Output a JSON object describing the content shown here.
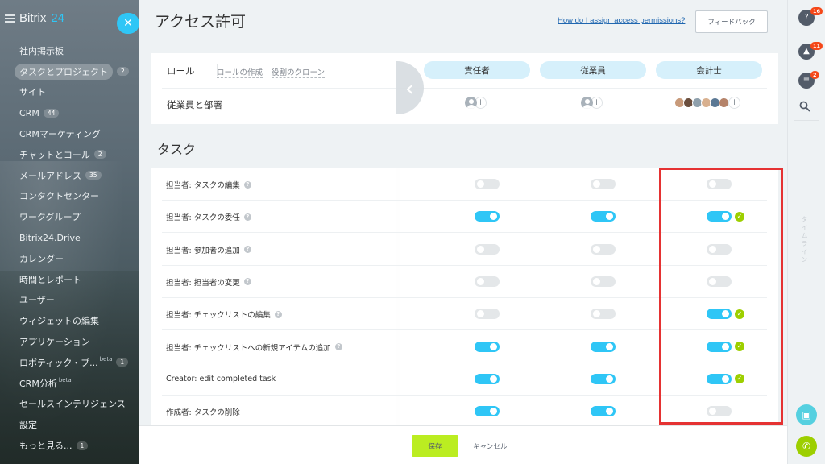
{
  "sidebar": {
    "logo_main": "Bitrix",
    "logo_accent": "24",
    "close_symbol": "✕",
    "items": [
      {
        "label": "社内掲示板",
        "badge": null,
        "sup": null
      },
      {
        "label": "タスクとプロジェクト",
        "badge": "2",
        "sup": null,
        "active": true
      },
      {
        "label": "サイト",
        "badge": null,
        "sup": null
      },
      {
        "label": "CRM",
        "badge": "44",
        "sup": null
      },
      {
        "label": "CRMマーケティング",
        "badge": null,
        "sup": null
      },
      {
        "label": "チャットとコール",
        "badge": "2",
        "sup": null
      },
      {
        "label": "メールアドレス",
        "badge": "35",
        "sup": null
      },
      {
        "label": "コンタクトセンター",
        "badge": null,
        "sup": null
      },
      {
        "label": "ワークグループ",
        "badge": null,
        "sup": null
      },
      {
        "label": "Bitrix24.Drive",
        "badge": null,
        "sup": null
      },
      {
        "label": "カレンダー",
        "badge": null,
        "sup": null
      },
      {
        "label": "時間とレポート",
        "badge": null,
        "sup": null
      },
      {
        "label": "ユーザー",
        "badge": null,
        "sup": null
      },
      {
        "label": "ウィジェットの編集",
        "badge": null,
        "sup": null
      },
      {
        "label": "アプリケーション",
        "badge": null,
        "sup": null
      },
      {
        "label": "ロボティック・プ...",
        "badge": "1",
        "sup": "beta"
      },
      {
        "label": "CRM分析",
        "badge": null,
        "sup": "beta"
      },
      {
        "label": "セールスインテリジェンス",
        "badge": null,
        "sup": null
      },
      {
        "label": "設定",
        "badge": null,
        "sup": null
      },
      {
        "label": "もっと見る...",
        "badge": "1",
        "sup": null
      }
    ]
  },
  "header": {
    "title": "アクセス許可",
    "help_link": "How do I assign access permissions?",
    "feedback": "フィードバック"
  },
  "roles": {
    "label": "ロール",
    "create_role": "ロールの作成",
    "clone_role": "役割のクローン",
    "members_label": "従業員と部署",
    "columns": [
      "責任者",
      "従業員",
      "会計士"
    ]
  },
  "section_title": "タスク",
  "permissions": [
    {
      "label": "担当者: タスクの編集",
      "help": true,
      "values": [
        false,
        false,
        false
      ],
      "changed": [
        false,
        false,
        false
      ]
    },
    {
      "label": "担当者: タスクの委任",
      "help": true,
      "values": [
        true,
        true,
        true
      ],
      "changed": [
        false,
        false,
        true
      ]
    },
    {
      "label": "担当者: 参加者の追加",
      "help": true,
      "values": [
        false,
        false,
        false
      ],
      "changed": [
        false,
        false,
        false
      ]
    },
    {
      "label": "担当者: 担当者の変更",
      "help": true,
      "values": [
        false,
        false,
        false
      ],
      "changed": [
        false,
        false,
        false
      ]
    },
    {
      "label": "担当者: チェックリストの編集",
      "help": true,
      "values": [
        false,
        false,
        true
      ],
      "changed": [
        false,
        false,
        true
      ]
    },
    {
      "label": "担当者: チェックリストへの新規アイテムの追加",
      "help": true,
      "values": [
        true,
        true,
        true
      ],
      "changed": [
        false,
        false,
        true
      ]
    },
    {
      "label": "Creator: edit completed task",
      "help": false,
      "values": [
        true,
        true,
        true
      ],
      "changed": [
        false,
        false,
        true
      ]
    },
    {
      "label": "作成者: タスクの削除",
      "help": false,
      "values": [
        true,
        true,
        false
      ],
      "changed": [
        false,
        false,
        false
      ]
    }
  ],
  "footer": {
    "save": "保存",
    "cancel": "キャンセル"
  },
  "rightbar": {
    "help_badge": "16",
    "notif_badge": "11",
    "chat_badge": "2",
    "vertical_text": "タイムライン"
  },
  "colors": {
    "accent": "#2fc6f6",
    "save": "#bbed21",
    "check": "#9dcf00",
    "highlight": "#e53232"
  }
}
